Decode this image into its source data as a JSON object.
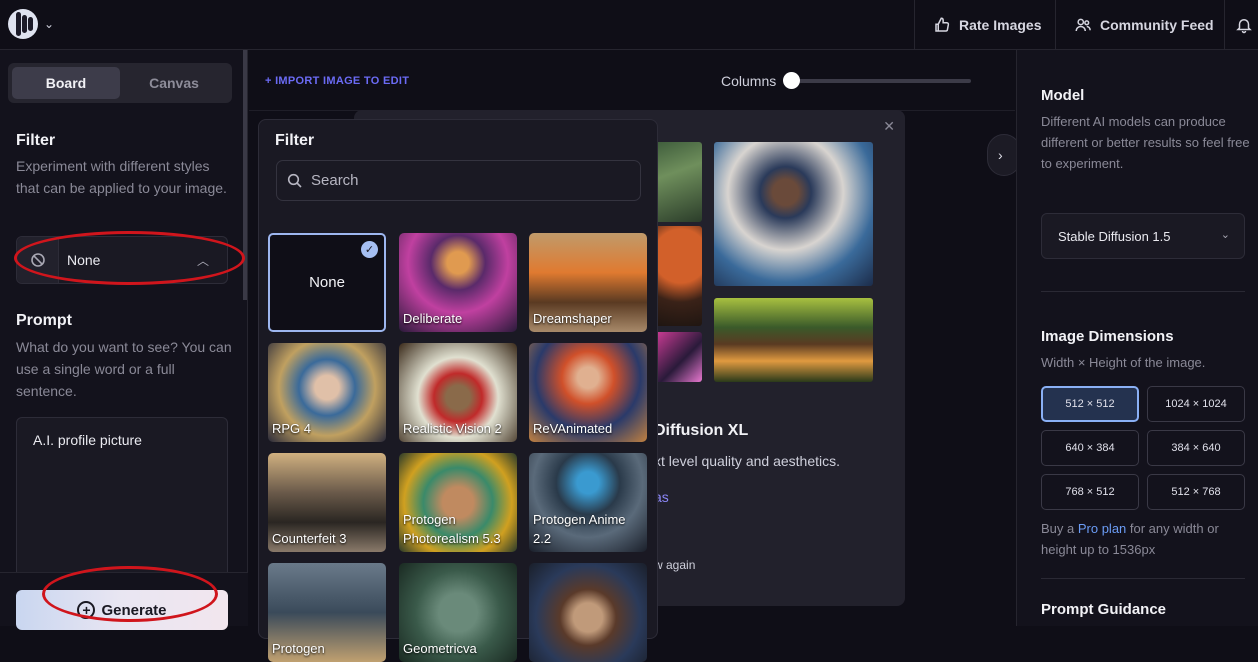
{
  "topbar": {
    "rate_images": "Rate Images",
    "community_feed": "Community Feed"
  },
  "left": {
    "tabs": [
      "Board",
      "Canvas"
    ],
    "filter_title": "Filter",
    "filter_desc": "Experiment with different styles that can be applied to your image.",
    "filter_value": "None",
    "prompt_title": "Prompt",
    "prompt_desc": "What do you want to see? You can use a single word or a full sentence.",
    "prompt_value": "A.I. profile picture",
    "generate_label": "Generate"
  },
  "center": {
    "import_label": "+ IMPORT IMAGE TO EDIT",
    "columns_label": "Columns",
    "columns_value": 0
  },
  "modal": {
    "title": "Diffusion XL",
    "desc": "xt level quality and aesthetics.",
    "link": "as",
    "small": "w again"
  },
  "popup": {
    "title": "Filter",
    "search_placeholder": "Search",
    "filters": [
      {
        "name": "None",
        "selected": true
      },
      {
        "name": "Deliberate"
      },
      {
        "name": "Dreamshaper"
      },
      {
        "name": "RPG 4"
      },
      {
        "name": "Realistic Vision 2"
      },
      {
        "name": "ReVAnimated"
      },
      {
        "name": "Counterfeit 3"
      },
      {
        "name": "Protogen Photorealism 5.3"
      },
      {
        "name": "Protogen Anime 2.2"
      },
      {
        "name": "Protogen"
      },
      {
        "name": "Geometricva"
      },
      {
        "name": ""
      }
    ]
  },
  "right": {
    "model_title": "Model",
    "model_desc": "Different AI models can produce different or better results so feel free to experiment.",
    "model_value": "Stable Diffusion 1.5",
    "dim_title": "Image Dimensions",
    "dim_desc": "Width × Height of the image.",
    "dimensions": [
      "512 × 512",
      "1024 × 1024",
      "640 × 384",
      "384 × 640",
      "768 × 512",
      "512 × 768"
    ],
    "active_dimension": "512 × 512",
    "pro_prefix": "Buy a ",
    "pro_link": "Pro plan",
    "pro_suffix": " for any width or height up to 1536px",
    "guidance_title": "Prompt Guidance"
  },
  "colors": {
    "accent": "#6b6bf5",
    "annotation_red": "#d0151c",
    "background": "#0f0e17"
  }
}
